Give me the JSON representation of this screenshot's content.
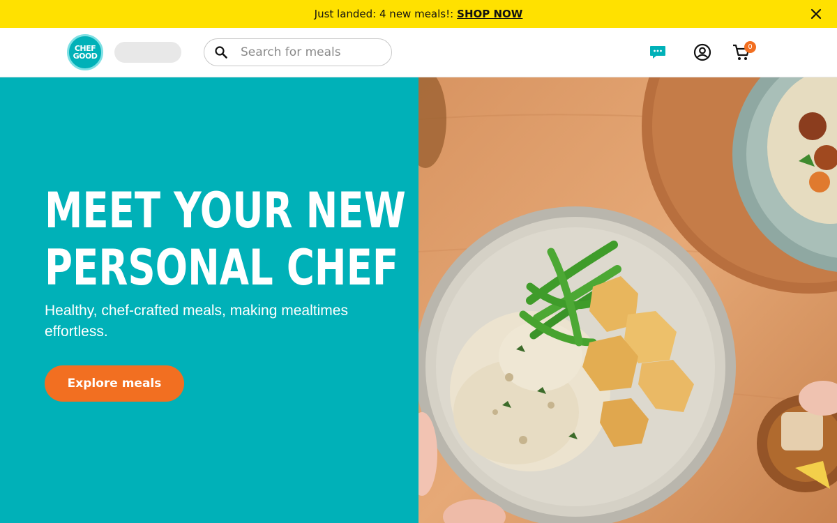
{
  "promo": {
    "text": "Just landed: 4 new meals!:",
    "link": "SHOP NOW"
  },
  "header": {
    "logo_line1": "CHEF",
    "logo_line2": "GOOD",
    "search_placeholder": "Search for meals",
    "cart_count": "0"
  },
  "hero": {
    "headline_line1": "MEET YOUR NEW",
    "headline_line2": "PERSONAL CHEF",
    "subtext": "Healthy, chef-crafted meals, making mealtimes effortless.",
    "cta_label": "Explore meals"
  },
  "colors": {
    "promo_bg": "#ffe100",
    "brand_teal": "#00b1b8",
    "cta_orange": "#f26f21"
  },
  "icons": [
    "close-icon",
    "search-icon",
    "chat-icon",
    "account-icon",
    "cart-icon"
  ]
}
